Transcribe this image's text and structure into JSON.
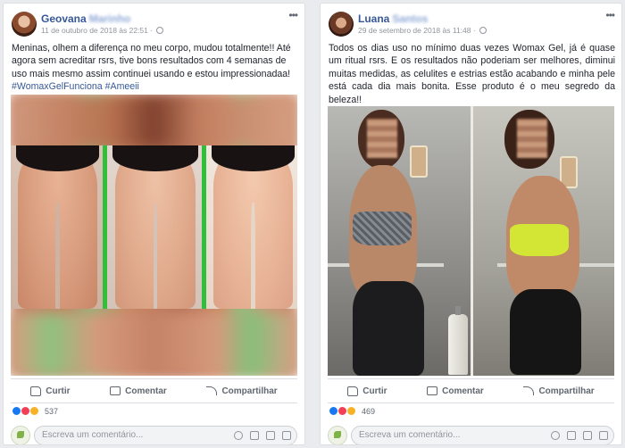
{
  "posts": [
    {
      "author": "Geovana",
      "author_surname_obscured": "Marinho",
      "timestamp": "11 de outubro de 2018 às 22:51",
      "text": "Meninas, olhem a diferença no meu corpo, mudou totalmente!! Até agora sem acreditar rsrs, tive bons resultados com 4 semanas de uso mais mesmo assim continuei usando e estou impressionadaa!",
      "hashtags": "#WomaxGelFunciona #Ameeii",
      "actions": {
        "like": "Curtir",
        "comment": "Comentar",
        "share": "Compartilhar"
      },
      "reaction_count": "537",
      "comment_placeholder": "Escreva um comentário..."
    },
    {
      "author": "Luana",
      "author_surname_obscured": "Santos",
      "timestamp": "29 de setembro de 2018 às 11:48",
      "text": "Todos os dias uso no mínimo duas vezes Womax Gel, já é quase um ritual rsrs. E os resultados não poderiam ser melhores, diminui muitas medidas, as celulites e estrias estão acabando e minha pele está cada dia mais bonita. Esse produto é o meu segredo da beleza!!",
      "actions": {
        "like": "Curtir",
        "comment": "Comentar",
        "share": "Compartilhar"
      },
      "reaction_count": "469",
      "comment_placeholder": "Escreva um comentário..."
    }
  ],
  "colors": {
    "link_blue": "#365899",
    "separator_green": "#2fbf3a",
    "like_blue": "#1877f2",
    "love_red": "#f33e58",
    "wow_yellow": "#f7b125"
  }
}
